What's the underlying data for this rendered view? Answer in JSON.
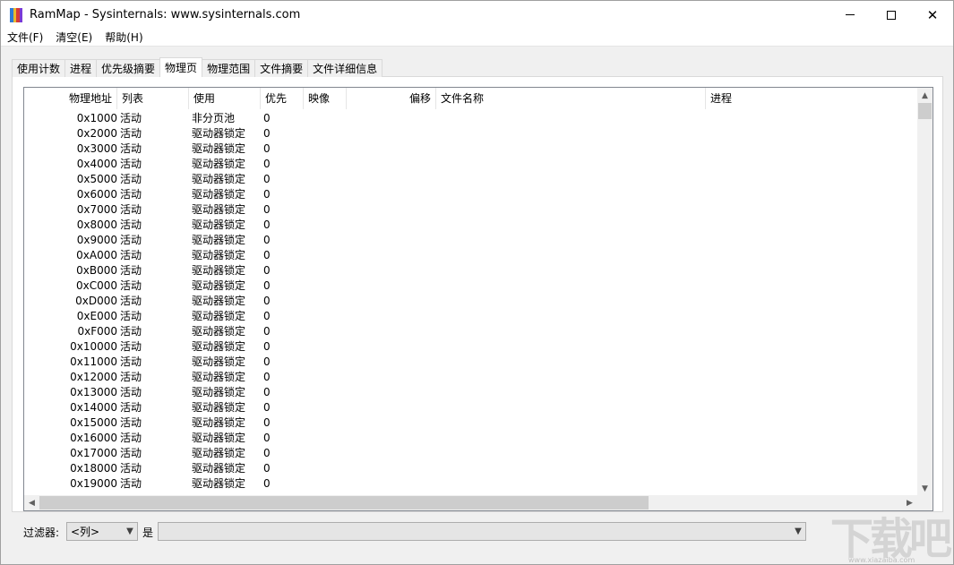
{
  "window": {
    "title": "RamMap - Sysinternals: www.sysinternals.com",
    "icon_colors": [
      "#2e7bd6",
      "#e8b92e",
      "#d63a3a",
      "#7a3ad6"
    ]
  },
  "menu": [
    "文件(F)",
    "清空(E)",
    "帮助(H)"
  ],
  "tabs": [
    {
      "label": "使用计数",
      "active": false
    },
    {
      "label": "进程",
      "active": false
    },
    {
      "label": "优先级摘要",
      "active": false
    },
    {
      "label": "物理页",
      "active": true
    },
    {
      "label": "物理范围",
      "active": false
    },
    {
      "label": "文件摘要",
      "active": false
    },
    {
      "label": "文件详细信息",
      "active": false
    }
  ],
  "table": {
    "columns": [
      "物理地址",
      "列表",
      "使用",
      "优先",
      "映像",
      "偏移",
      "文件名称",
      "进程"
    ],
    "rows": [
      [
        "0x1000",
        "活动",
        "非分页池",
        "0"
      ],
      [
        "0x2000",
        "活动",
        "驱动器锁定",
        "0"
      ],
      [
        "0x3000",
        "活动",
        "驱动器锁定",
        "0"
      ],
      [
        "0x4000",
        "活动",
        "驱动器锁定",
        "0"
      ],
      [
        "0x5000",
        "活动",
        "驱动器锁定",
        "0"
      ],
      [
        "0x6000",
        "活动",
        "驱动器锁定",
        "0"
      ],
      [
        "0x7000",
        "活动",
        "驱动器锁定",
        "0"
      ],
      [
        "0x8000",
        "活动",
        "驱动器锁定",
        "0"
      ],
      [
        "0x9000",
        "活动",
        "驱动器锁定",
        "0"
      ],
      [
        "0xA000",
        "活动",
        "驱动器锁定",
        "0"
      ],
      [
        "0xB000",
        "活动",
        "驱动器锁定",
        "0"
      ],
      [
        "0xC000",
        "活动",
        "驱动器锁定",
        "0"
      ],
      [
        "0xD000",
        "活动",
        "驱动器锁定",
        "0"
      ],
      [
        "0xE000",
        "活动",
        "驱动器锁定",
        "0"
      ],
      [
        "0xF000",
        "活动",
        "驱动器锁定",
        "0"
      ],
      [
        "0x10000",
        "活动",
        "驱动器锁定",
        "0"
      ],
      [
        "0x11000",
        "活动",
        "驱动器锁定",
        "0"
      ],
      [
        "0x12000",
        "活动",
        "驱动器锁定",
        "0"
      ],
      [
        "0x13000",
        "活动",
        "驱动器锁定",
        "0"
      ],
      [
        "0x14000",
        "活动",
        "驱动器锁定",
        "0"
      ],
      [
        "0x15000",
        "活动",
        "驱动器锁定",
        "0"
      ],
      [
        "0x16000",
        "活动",
        "驱动器锁定",
        "0"
      ],
      [
        "0x17000",
        "活动",
        "驱动器锁定",
        "0"
      ],
      [
        "0x18000",
        "活动",
        "驱动器锁定",
        "0"
      ],
      [
        "0x19000",
        "活动",
        "驱动器锁定",
        "0"
      ]
    ]
  },
  "filter": {
    "label": "过滤器:",
    "column_value": "<列>",
    "is_label": "是",
    "value": ""
  },
  "watermark": {
    "text": "下载吧",
    "url": "www.xiazaiba.com"
  }
}
